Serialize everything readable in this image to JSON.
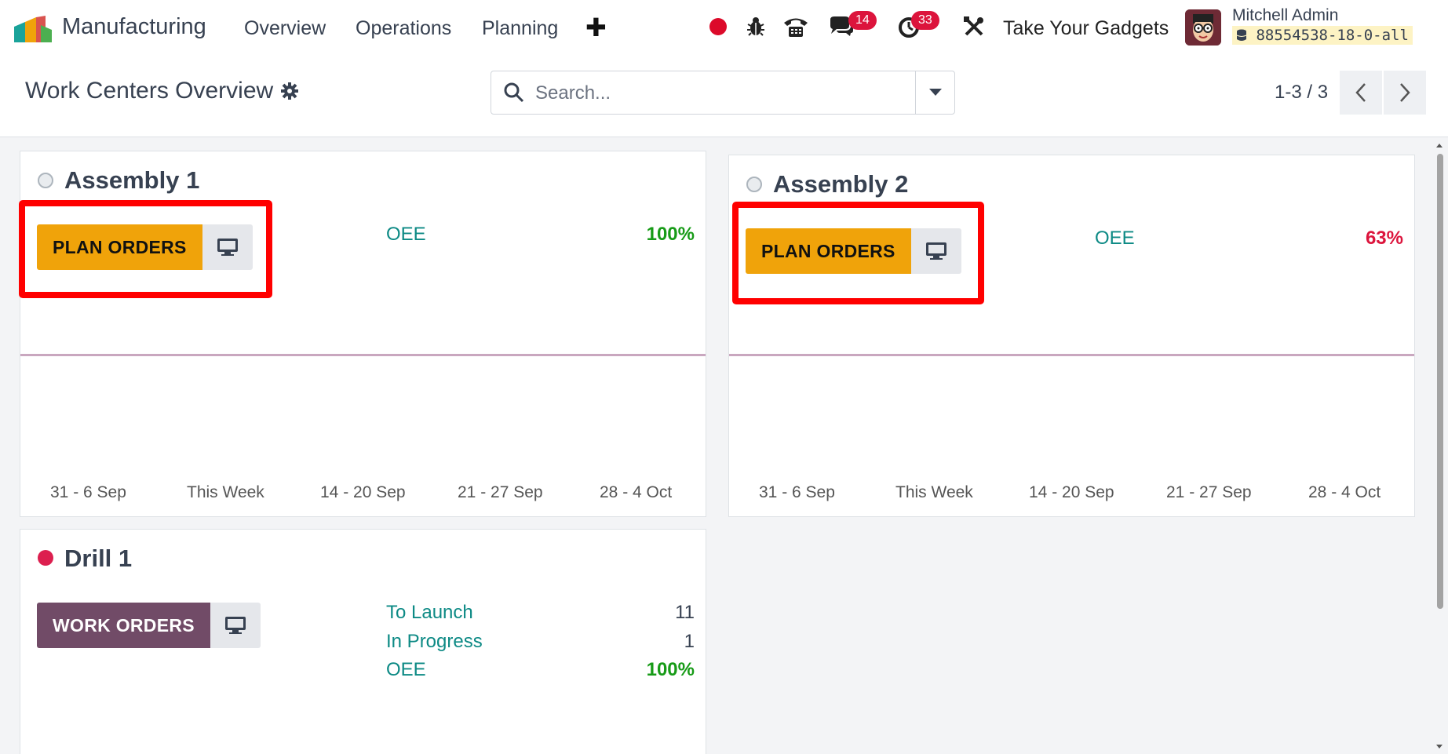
{
  "navbar": {
    "app_name": "Manufacturing",
    "menu": [
      "Overview",
      "Operations",
      "Planning"
    ],
    "plus_icon": "plus-icon",
    "messages_badge": "14",
    "activities_badge": "33",
    "company": "Take Your Gadgets",
    "user_name": "Mitchell Admin",
    "db_name": "88554538-18-0-all"
  },
  "control_panel": {
    "title": "Work Centers Overview",
    "search_placeholder": "Search...",
    "pager": "1-3 / 3"
  },
  "colors": {
    "plan_button": "#f0a30a",
    "work_button": "#714b67",
    "highlight": "#ff0000",
    "kpi_label": "#0d8a85",
    "good": "#179b17",
    "bad": "#dc143c"
  },
  "cards": [
    {
      "name": "Assembly 1",
      "button": "PLAN ORDERS",
      "oee_label": "OEE",
      "oee_value": "100%",
      "ticks": [
        "31 - 6 Sep",
        "This Week",
        "14 - 20 Sep",
        "21 - 27 Sep",
        "28 - 4 Oct"
      ]
    },
    {
      "name": "Assembly 2",
      "button": "PLAN ORDERS",
      "oee_label": "OEE",
      "oee_value": "63%",
      "ticks": [
        "31 - 6 Sep",
        "This Week",
        "14 - 20 Sep",
        "21 - 27 Sep",
        "28 - 4 Oct"
      ]
    },
    {
      "name": "Drill 1",
      "button": "WORK ORDERS",
      "to_launch_label": "To Launch",
      "to_launch_value": "11",
      "in_progress_label": "In Progress",
      "in_progress_value": "1",
      "oee_label": "OEE",
      "oee_value": "100%"
    }
  ]
}
